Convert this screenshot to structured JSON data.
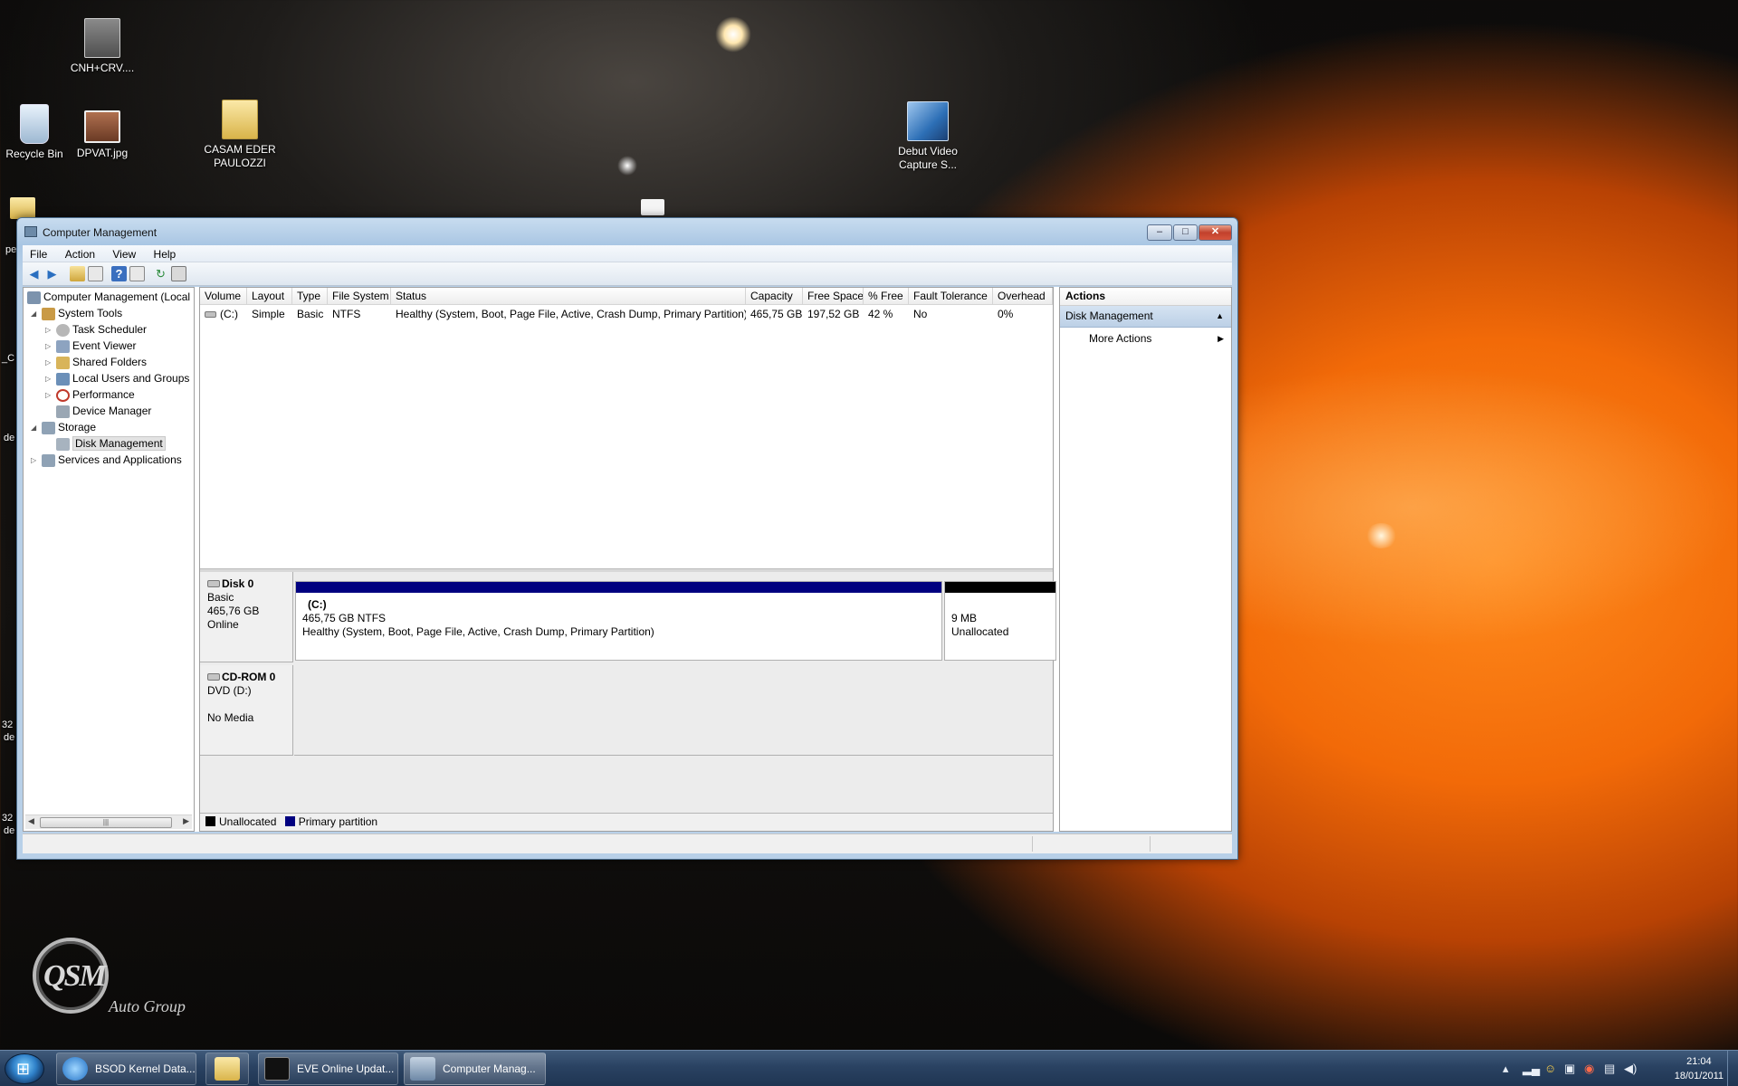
{
  "desktop": {
    "icons": {
      "cnh": "CNH+CRV....",
      "recycle_bin": "Recycle Bin",
      "dpvat": "DPVAT.jpg",
      "casam_line1": "CASAM EDER",
      "casam_line2": "PAULOZZI",
      "debut_line1": "Debut Video",
      "debut_line2": "Capture S..."
    },
    "fragments": [
      "pe",
      "_C",
      "de",
      "32",
      "de",
      "32",
      "de"
    ],
    "logo": {
      "text": "QSM",
      "tagline": "Auto Group"
    }
  },
  "window": {
    "title": "Computer Management",
    "controls": {
      "minimize": "–",
      "maximize": "□",
      "close": "✕"
    },
    "menu": [
      "File",
      "Action",
      "View",
      "Help"
    ],
    "tree": {
      "root": "Computer Management (Local",
      "system_tools": "System Tools",
      "task_scheduler": "Task Scheduler",
      "event_viewer": "Event Viewer",
      "shared_folders": "Shared Folders",
      "local_users": "Local Users and Groups",
      "performance": "Performance",
      "device_manager": "Device Manager",
      "storage": "Storage",
      "disk_management": "Disk Management",
      "services": "Services and Applications"
    },
    "volume_table": {
      "headers": [
        "Volume",
        "Layout",
        "Type",
        "File System",
        "Status",
        "Capacity",
        "Free Space",
        "% Free",
        "Fault Tolerance",
        "Overhead"
      ],
      "rows": [
        [
          "(C:)",
          "Simple",
          "Basic",
          "NTFS",
          "Healthy (System, Boot, Page File, Active, Crash Dump, Primary Partition)",
          "465,75 GB",
          "197,52 GB",
          "42 %",
          "No",
          "0%"
        ]
      ]
    },
    "disks": {
      "disk0": {
        "name": "Disk 0",
        "type": "Basic",
        "size": "465,76 GB",
        "state": "Online"
      },
      "partition_c": {
        "label": "(C:)",
        "size_fs": "465,75 GB NTFS",
        "status": "Healthy (System, Boot, Page File, Active, Crash Dump, Primary Partition)"
      },
      "unallocated": {
        "size": "9 MB",
        "label": "Unallocated"
      },
      "cdrom": {
        "name": "CD-ROM 0",
        "type": "DVD (D:)",
        "state": "No Media"
      }
    },
    "legend": {
      "unallocated": "Unallocated",
      "primary": "Primary partition"
    },
    "actions": {
      "header": "Actions",
      "group": "Disk Management",
      "more": "More Actions"
    }
  },
  "taskbar": {
    "buttons": [
      "BSOD Kernel Data...",
      "EVE Online Updat...",
      "Computer Manag..."
    ],
    "clock_time": "21:04",
    "clock_date": "18/01/2011"
  },
  "colors": {
    "primary_partition": "#000080",
    "unallocated": "#000000",
    "selection_header": "#bcd0e6",
    "car_orange": "#f26a08"
  }
}
